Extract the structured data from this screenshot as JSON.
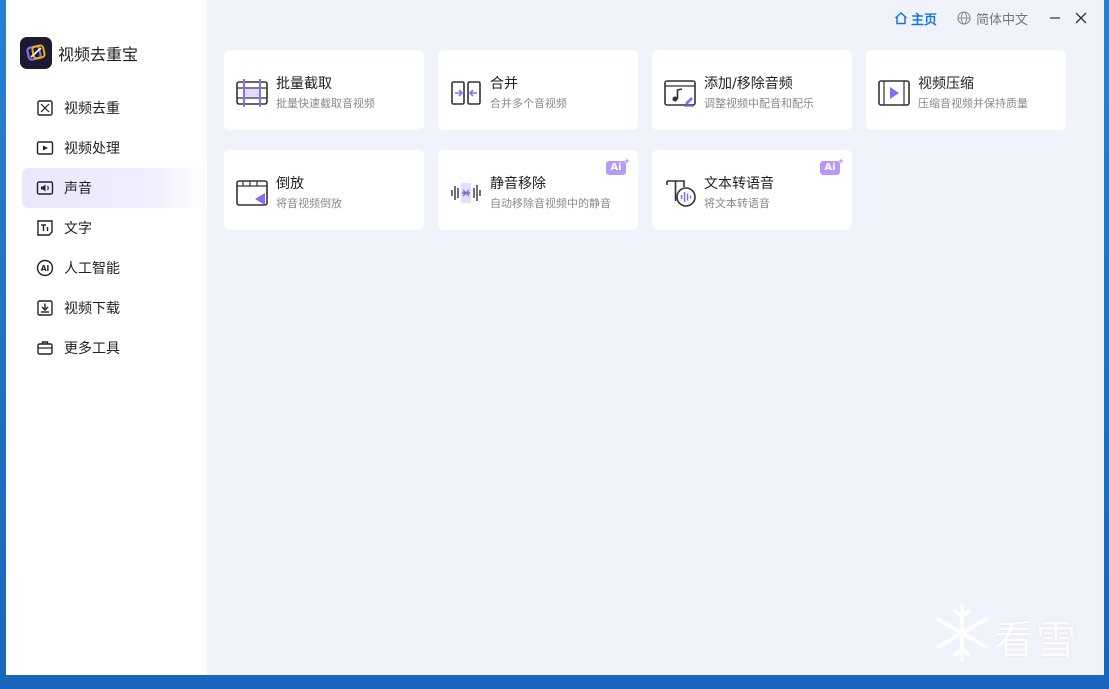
{
  "app": {
    "name": "视频去重宝"
  },
  "topbar": {
    "home_label": "主页",
    "language_label": "简体中文"
  },
  "sidebar": {
    "items": [
      {
        "label": "视频去重",
        "icon": "video-dedupe-icon"
      },
      {
        "label": "视频处理",
        "icon": "video-play-icon"
      },
      {
        "label": "声音",
        "icon": "sound-icon"
      },
      {
        "label": "文字",
        "icon": "text-icon"
      },
      {
        "label": "人工智能",
        "icon": "ai-icon"
      },
      {
        "label": "视频下载",
        "icon": "download-icon"
      },
      {
        "label": "更多工具",
        "icon": "toolbox-icon"
      }
    ],
    "active_index": 2
  },
  "tools": [
    {
      "title": "批量截取",
      "subtitle": "批量快速截取音视频",
      "icon": "batch-trim-icon",
      "ai": false
    },
    {
      "title": "合并",
      "subtitle": "合并多个音视频",
      "icon": "merge-icon",
      "ai": false
    },
    {
      "title": "添加/移除音频",
      "subtitle": "调整视频中配音和配乐",
      "icon": "add-remove-audio-icon",
      "ai": false
    },
    {
      "title": "视频压缩",
      "subtitle": "压缩音视频并保持质量",
      "icon": "compress-icon",
      "ai": false
    },
    {
      "title": "倒放",
      "subtitle": "将音视频倒放",
      "icon": "reverse-icon",
      "ai": false
    },
    {
      "title": "静音移除",
      "subtitle": "自动移除音视频中的静音",
      "icon": "silence-remove-icon",
      "ai": true
    },
    {
      "title": "文本转语音",
      "subtitle": "将文本转语音",
      "icon": "text-to-speech-icon",
      "ai": true
    }
  ],
  "badges": {
    "ai_label": "Ai"
  },
  "watermark": {
    "text": "看雪"
  },
  "colors": {
    "accent": "#1677d9",
    "purple": "#8b6cf0",
    "badge": "#b79af5"
  }
}
